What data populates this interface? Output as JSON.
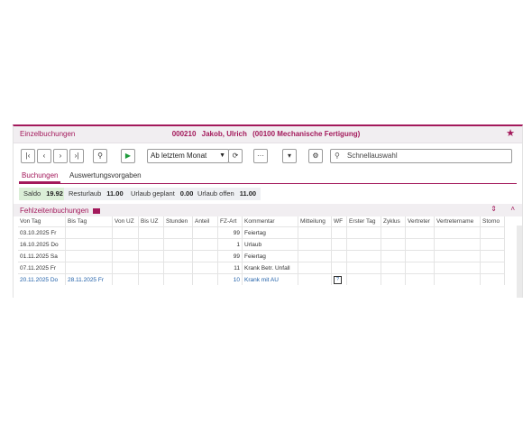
{
  "header": {
    "left_title": "Einzelbuchungen",
    "employee_id": "000210",
    "employee_name": "Jakob, Ulrich",
    "department": "(00100 Mechanische Fertigung)"
  },
  "toolbar": {
    "period_select": "Ab letztem Monat",
    "search_placeholder": "Schnellauswahl"
  },
  "tabs": [
    {
      "label": "Buchungen",
      "active": true
    },
    {
      "label": "Auswertungsvorgaben",
      "active": false
    }
  ],
  "stats": [
    {
      "label": "Saldo",
      "value": "19.92"
    },
    {
      "label": "Resturlaub",
      "value": "11.00"
    },
    {
      "label": "Urlaub geplant",
      "value": "0.00"
    },
    {
      "label": "Urlaub offen",
      "value": "11.00"
    }
  ],
  "section": {
    "title": "Fehlzeitenbuchungen"
  },
  "table": {
    "columns": [
      "Von Tag",
      "Bis Tag",
      "Von UZ",
      "Bis UZ",
      "Stunden",
      "Anteil",
      "FZ-Art",
      "Kommentar",
      "Mitteilung",
      "WF",
      "Erster Tag",
      "Zyklus",
      "Vertreter",
      "Vertretername",
      "Storno"
    ],
    "rows": [
      [
        "03.10.2025 Fr",
        "",
        "",
        "",
        "",
        "",
        "99",
        "Feiertag",
        "",
        "",
        "",
        "",
        "",
        "",
        ""
      ],
      [
        "16.10.2025 Do",
        "",
        "",
        "",
        "",
        "",
        "1",
        "Urlaub",
        "",
        "",
        "",
        "",
        "",
        "",
        ""
      ],
      [
        "01.11.2025 Sa",
        "",
        "",
        "",
        "",
        "",
        "99",
        "Feiertag",
        "",
        "",
        "",
        "",
        "",
        "",
        ""
      ],
      [
        "07.11.2025 Fr",
        "",
        "",
        "",
        "",
        "",
        "11",
        "Krank Betr. Unfall",
        "",
        "",
        "",
        "",
        "",
        "",
        ""
      ],
      [
        "20.11.2025 Do",
        "28.11.2025 Fr",
        "",
        "",
        "",
        "",
        "10",
        "Krank mit AU",
        "",
        "?",
        "",
        "",
        "",
        "",
        ""
      ]
    ]
  },
  "colors": {
    "accent": "#a3195b",
    "link": "#1f5fa8",
    "saldo_bg": "#dbefd7"
  }
}
